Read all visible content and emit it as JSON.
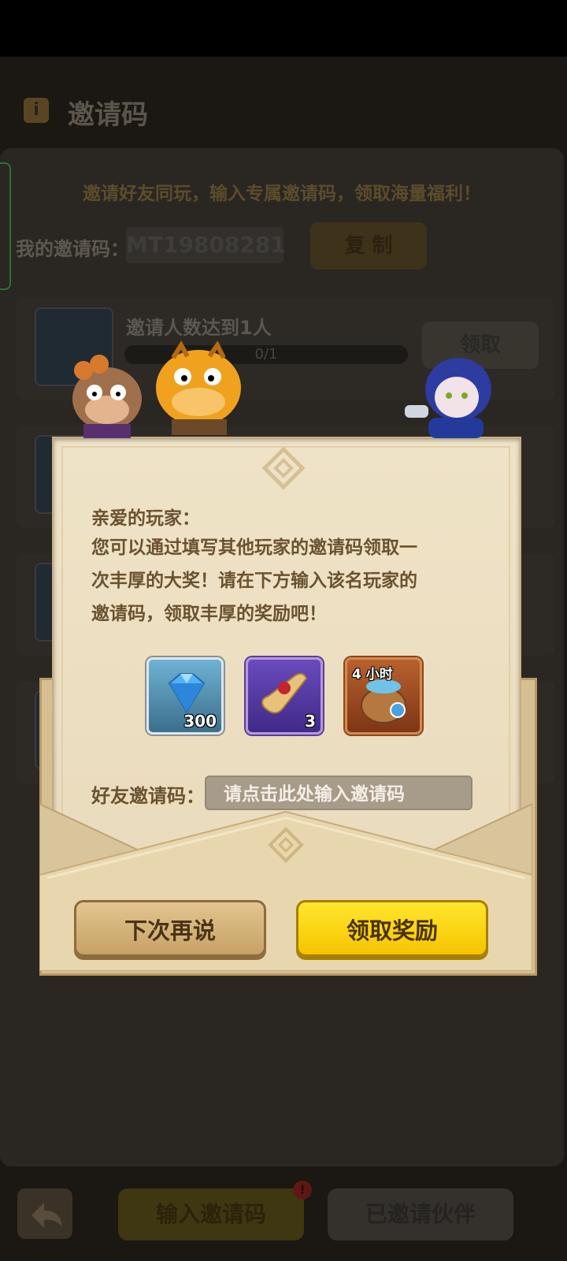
{
  "background": {
    "title": "邀请码",
    "intro": "邀请好友同玩，输入专属邀请码，领取海量福利！",
    "my_code_label": "我的邀请码：",
    "my_code_value": "MT19808281",
    "copy_label": "复 制",
    "tasks": [
      {
        "title": "邀请人数达到1人",
        "progress": "0/1",
        "progress_fraction": 0,
        "button": "领取"
      }
    ],
    "bottom_bar": {
      "enter_code_label": "输入邀请码",
      "invited_label": "已邀请伙伴",
      "badge": "!"
    }
  },
  "dialog": {
    "greeting": "亲爱的玩家：",
    "lines": [
      "您可以通过填写其他玩家的邀请码领取一",
      "次丰厚的大奖！请在下方输入该名玩家的",
      "邀请码，领取丰厚的奖励吧！"
    ],
    "rewards": [
      {
        "icon": "diamond-icon",
        "count": "300"
      },
      {
        "icon": "scroll-icon",
        "count": "3"
      },
      {
        "icon": "loot-bag-icon",
        "timer": "4 小时"
      }
    ],
    "friend_code_label": "好友邀请码：",
    "friend_code_placeholder": "请点击此处输入邀请码",
    "later_button": "下次再说",
    "claim_button": "领取奖励"
  }
}
